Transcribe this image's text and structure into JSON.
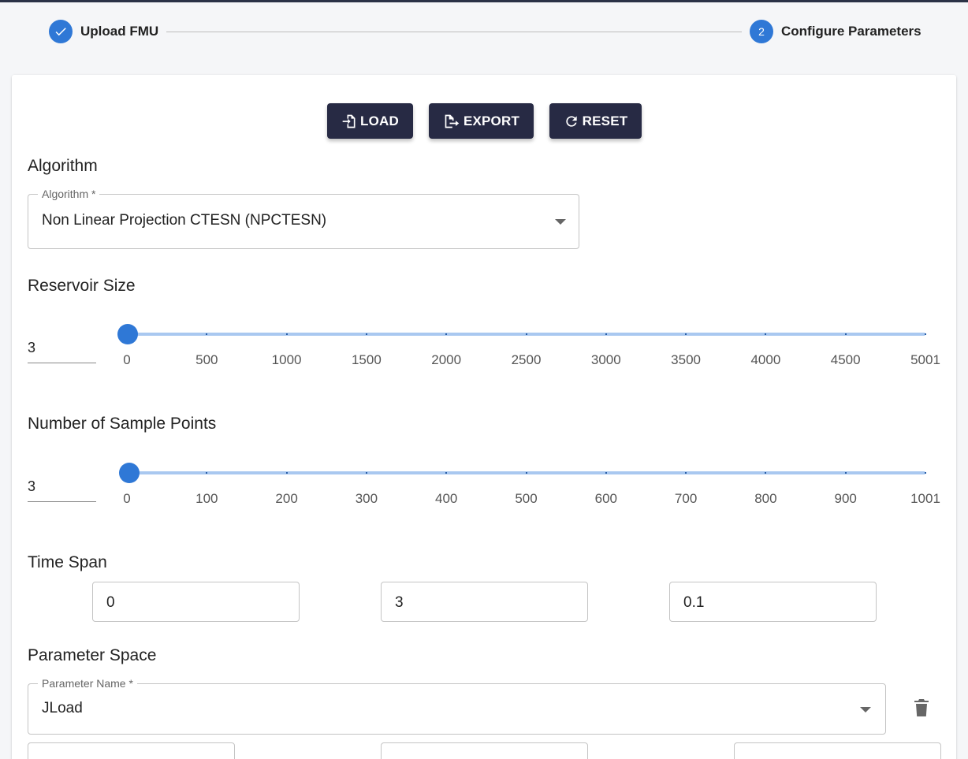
{
  "stepper": {
    "steps": [
      {
        "label": "Upload FMU",
        "icon": "check-icon",
        "status": "completed"
      },
      {
        "label": "Configure Parameters",
        "number": "2",
        "status": "active"
      }
    ]
  },
  "toolbar": {
    "load_label": "LOAD",
    "export_label": "EXPORT",
    "reset_label": "RESET"
  },
  "algorithm": {
    "section_title": "Algorithm",
    "field_label": "Algorithm *",
    "value": "Non Linear Projection CTESN (NPCTESN)"
  },
  "reservoir_size": {
    "section_title": "Reservoir Size",
    "value": "3",
    "slider_value": 3,
    "slider_min": 0,
    "slider_max": 5001,
    "tick_labels": [
      "0",
      "500",
      "1000",
      "1500",
      "2000",
      "2500",
      "3000",
      "3500",
      "4000",
      "4500",
      "5001"
    ]
  },
  "sample_points": {
    "section_title": "Number of Sample Points",
    "value": "3",
    "slider_value": 3,
    "slider_min": 0,
    "slider_max": 1001,
    "tick_labels": [
      "0",
      "100",
      "200",
      "300",
      "400",
      "500",
      "600",
      "700",
      "800",
      "900",
      "1001"
    ]
  },
  "time_span": {
    "section_title": "Time Span",
    "start": "0",
    "stop": "3",
    "step": "0.1"
  },
  "parameter_space": {
    "section_title": "Parameter Space",
    "field_label": "Parameter Name *",
    "value": "JLoad"
  },
  "colors": {
    "primary": "#2f78d6",
    "button_bg": "#272a44"
  }
}
